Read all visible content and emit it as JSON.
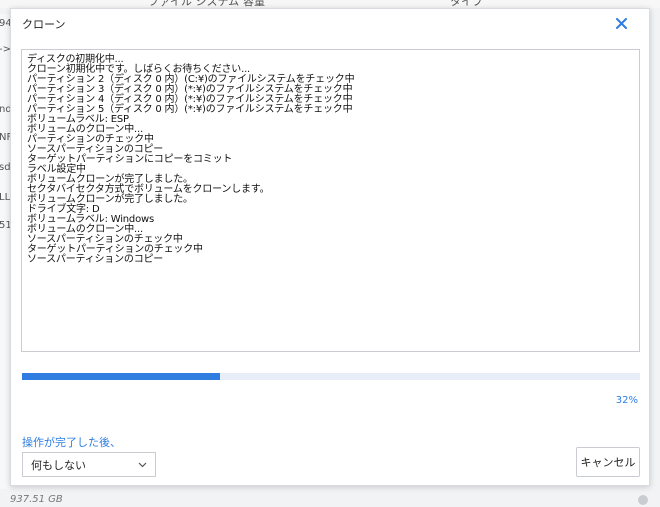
{
  "background": {
    "header_columns": [
      "ファイル システム",
      "容量",
      "タイプ"
    ],
    "left_fragments": [
      "94",
      "->",
      "nd",
      "NF",
      "sd",
      "LL",
      "51"
    ],
    "footer_text": "937.51 GB"
  },
  "dialog": {
    "title": "クローン",
    "close_icon": "close-icon",
    "log_lines": [
      "ディスクの初期化中...",
      "クローン初期化中です。しばらくお待ちください...",
      "パーティション 2（ディスク 0 内）(C:¥)のファイルシステムをチェック中",
      "パーティション 3（ディスク 0 内）(*:¥)のファイルシステムをチェック中",
      "パーティション 4（ディスク 0 内）(*:¥)のファイルシステムをチェック中",
      "パーティション 5（ディスク 0 内）(*:¥)のファイルシステムをチェック中",
      "ボリュームラベル: ESP",
      "ボリュームのクローン中...",
      "パーティションのチェック中",
      "ソースパーティションのコピー",
      "ターゲットパーティションにコピーをコミット",
      "ラベル設定中",
      "ボリュームクローンが完了しました。",
      "セクタバイセクタ方式でボリュームをクローンします。",
      "ボリュームクローンが完了しました。",
      "ドライブ文字: D",
      "ボリュームラベル: Windows",
      "ボリュームのクローン中...",
      "ソースパーティションのチェック中",
      "ターゲットパーティションのチェック中",
      "ソースパーティションのコピー"
    ],
    "progress": {
      "percent": 32,
      "label": "32%"
    },
    "after_label": "操作が完了した後、",
    "after_select": {
      "value": "何もしない",
      "icon": "chevron-down-icon"
    },
    "cancel_label": "キャンセル",
    "colors": {
      "accent": "#2f7de1",
      "track": "#e8eef7",
      "border": "#c9ccd1"
    }
  }
}
